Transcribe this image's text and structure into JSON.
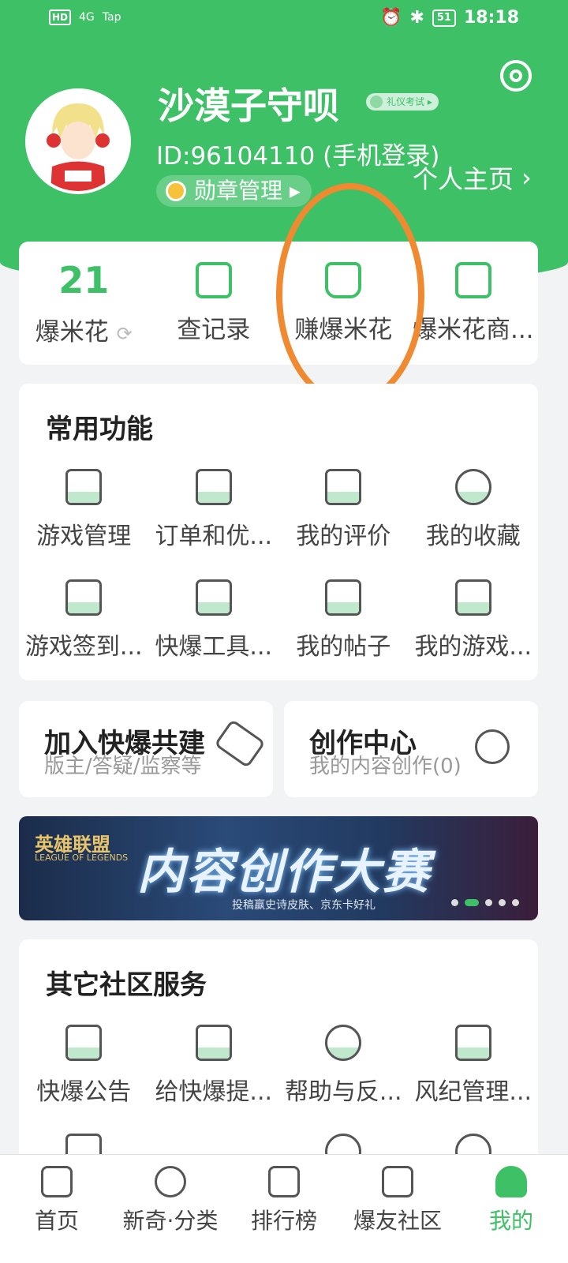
{
  "status_bar": {
    "left": [
      "HD",
      "4G",
      "Tap"
    ],
    "battery": "51",
    "time": "18:18"
  },
  "profile": {
    "username": "沙漠子守呗",
    "exam_badge": "礼仪考试",
    "uid": "ID:96104110 (手机登录)",
    "home_link": "个人主页",
    "medal_button": "勋章管理"
  },
  "top_card": {
    "popcorn_count": "21",
    "popcorn_label": "爆米花",
    "items": [
      "查记录",
      "赚爆米花",
      "爆米花商..."
    ]
  },
  "common": {
    "title": "常用功能",
    "row1": [
      "游戏管理",
      "订单和优...",
      "我的评价",
      "我的收藏"
    ],
    "row2": [
      "游戏签到...",
      "快爆工具...",
      "我的帖子",
      "我的游戏..."
    ]
  },
  "join": {
    "title": "加入快爆共建",
    "subtitle": "版主/答疑/监察等"
  },
  "creator": {
    "title": "创作中心",
    "subtitle": "我的内容创作(0)"
  },
  "banner": {
    "logo": "英雄联盟",
    "logo_sub": "LEAGUE OF LEGENDS",
    "title": "内容创作大赛",
    "subtitle": "投稿赢史诗皮肤、京东卡好礼"
  },
  "other": {
    "title": "其它社区服务",
    "row1": [
      "快爆公告",
      "给快爆提...",
      "帮助与反...",
      "风纪管理..."
    ]
  },
  "nav": [
    "首页",
    "新奇·分类",
    "排行榜",
    "爆友社区",
    "我的"
  ],
  "colors": {
    "brand": "#3ec067",
    "annotation": "#f08a30"
  }
}
